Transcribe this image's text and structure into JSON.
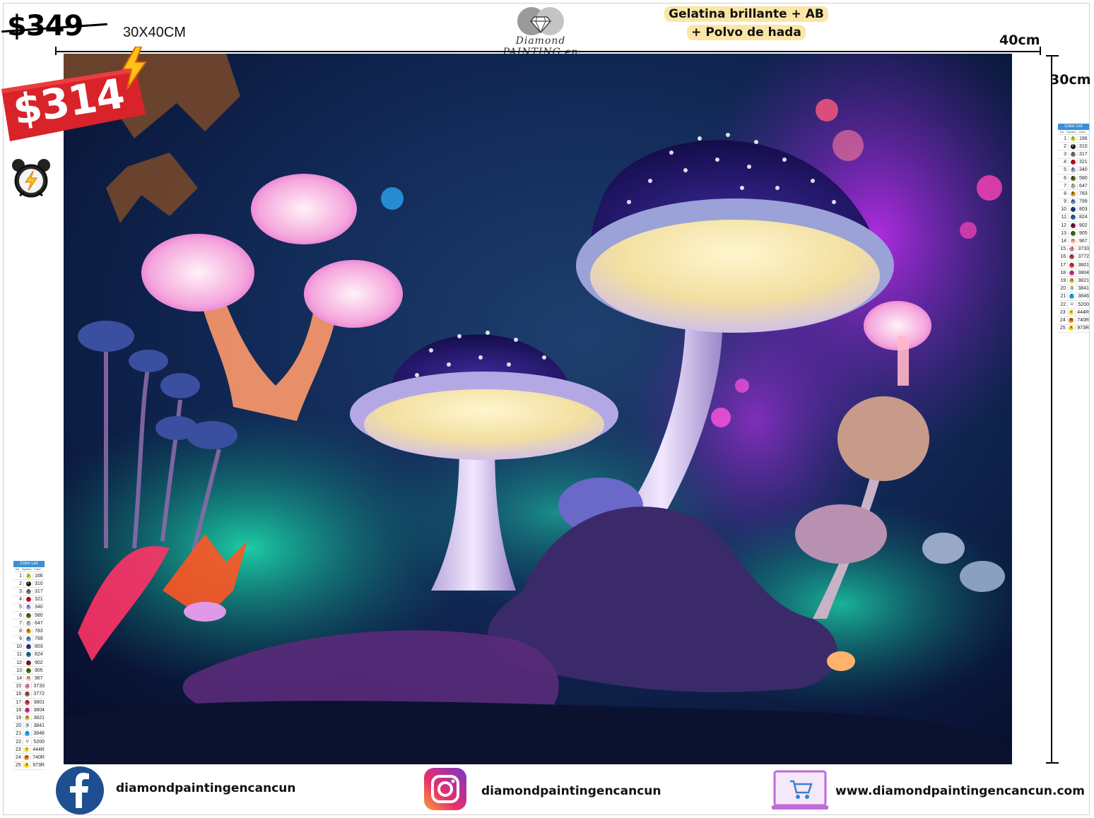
{
  "header": {
    "old_price": "$349",
    "size": "30X40CM",
    "logo_text": "Diamond PAINTING en Cancún",
    "promo_line1": "Gelatina brillante + AB",
    "promo_line2": "+ Polvo de hada",
    "width_label": "40cm",
    "height_label": "30cm"
  },
  "badge": {
    "price": "$314",
    "color": "#d8232a"
  },
  "legend": {
    "title": "Color List",
    "columns": [
      "No.",
      "Symbol",
      "Color"
    ],
    "rows": [
      {
        "n": "1",
        "s": "1",
        "c": "166",
        "color": "#c9d64a"
      },
      {
        "n": "2",
        "s": "2",
        "c": "310",
        "color": "#111111"
      },
      {
        "n": "3",
        "s": "3",
        "c": "317",
        "color": "#7a7a7a"
      },
      {
        "n": "4",
        "s": "4",
        "c": "321",
        "color": "#c8102e"
      },
      {
        "n": "5",
        "s": "5",
        "c": "340",
        "color": "#a9a3e0"
      },
      {
        "n": "6",
        "s": "6",
        "c": "580",
        "color": "#5a6b1c"
      },
      {
        "n": "7",
        "s": "7",
        "c": "647",
        "color": "#b8b8a8"
      },
      {
        "n": "8",
        "s": "8",
        "c": "783",
        "color": "#d79b2a"
      },
      {
        "n": "9",
        "s": "A",
        "c": "799",
        "color": "#6d93d1"
      },
      {
        "n": "10",
        "s": "C",
        "c": "803",
        "color": "#2a3f7a"
      },
      {
        "n": "11",
        "s": "D",
        "c": "824",
        "color": "#2f68a5"
      },
      {
        "n": "12",
        "s": "E",
        "c": "902",
        "color": "#7a1f3a"
      },
      {
        "n": "13",
        "s": "G",
        "c": "905",
        "color": "#3c7a1c"
      },
      {
        "n": "14",
        "s": "H",
        "c": "967",
        "color": "#f7c3b0"
      },
      {
        "n": "15",
        "s": "J",
        "c": "3733",
        "color": "#e38aa0"
      },
      {
        "n": "16",
        "s": "K",
        "c": "3772",
        "color": "#9c5a48"
      },
      {
        "n": "17",
        "s": "N",
        "c": "3801",
        "color": "#e0394a"
      },
      {
        "n": "18",
        "s": "O",
        "c": "3804",
        "color": "#e2338b"
      },
      {
        "n": "19",
        "s": "R",
        "c": "3821",
        "color": "#e9c548"
      },
      {
        "n": "20",
        "s": "S",
        "c": "3841",
        "color": "#cfe4f1"
      },
      {
        "n": "21",
        "s": "T",
        "c": "3846",
        "color": "#23a9e0"
      },
      {
        "n": "22",
        "s": "U",
        "c": "5200",
        "color": "#ffffff"
      },
      {
        "n": "23",
        "s": "V",
        "c": "444R",
        "color": "#f7e23a"
      },
      {
        "n": "24",
        "s": "W",
        "c": "740R",
        "color": "#f6861f"
      },
      {
        "n": "25",
        "s": "X",
        "c": "973R",
        "color": "#ffd400"
      }
    ]
  },
  "footer": {
    "facebook": "diamondpaintingencancun",
    "instagram": "diamondpaintingencancun",
    "website": "www.diamondpaintingencancun.com"
  },
  "icons": [
    "lightning-icon",
    "alarm-clock-icon",
    "diamond-logo-icon",
    "facebook-icon",
    "instagram-icon",
    "shopping-cart-icon"
  ]
}
